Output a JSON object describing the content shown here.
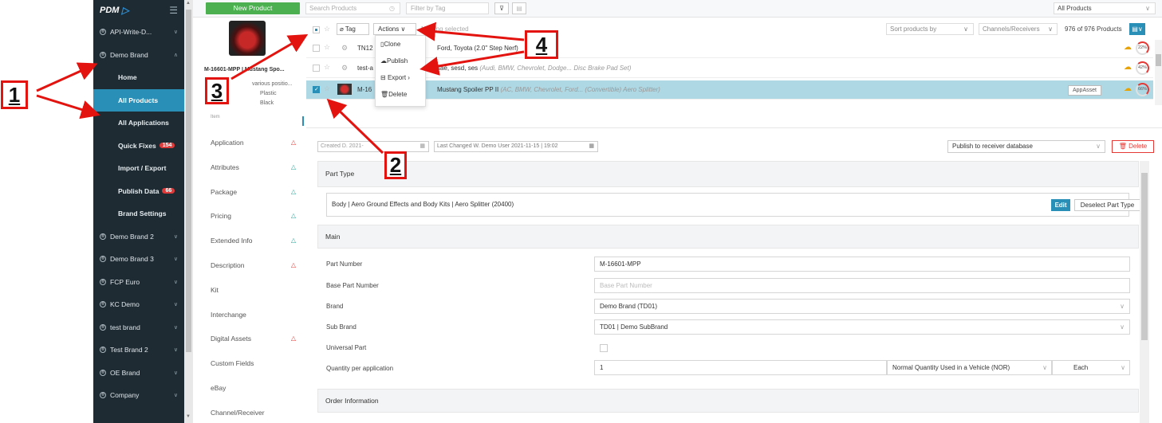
{
  "sidebar": {
    "logo": "PDM",
    "items": [
      {
        "label": "API-Write-D...",
        "type": "brand"
      },
      {
        "label": "Demo Brand",
        "type": "brand-open"
      },
      {
        "label": "Home",
        "type": "sub"
      },
      {
        "label": "All Products",
        "type": "sub-active"
      },
      {
        "label": "All Applications",
        "type": "sub"
      },
      {
        "label": "Quick Fixes",
        "type": "sub",
        "badge": "154"
      },
      {
        "label": "Import / Export",
        "type": "sub"
      },
      {
        "label": "Publish Data",
        "type": "sub",
        "badge": "66"
      },
      {
        "label": "Brand Settings",
        "type": "sub"
      },
      {
        "label": "Demo Brand 2",
        "type": "brand"
      },
      {
        "label": "Demo Brand 3",
        "type": "brand"
      },
      {
        "label": "FCP Euro",
        "type": "brand"
      },
      {
        "label": "KC Demo",
        "type": "brand"
      },
      {
        "label": "test brand",
        "type": "brand"
      },
      {
        "label": "Test Brand 2",
        "type": "brand"
      },
      {
        "label": "OE Brand",
        "type": "brand"
      },
      {
        "label": "Company",
        "type": "brand"
      }
    ]
  },
  "topbar": {
    "new_product": "New Product",
    "search_placeholder": "Search Products",
    "filter_placeholder": "Filter by Tag",
    "all_products": "All Products"
  },
  "preview": {
    "title": "M-16601-MPP | Mustang Spo...",
    "line1": "various positio...",
    "line2": "Plastic",
    "line3": "Black"
  },
  "list": {
    "tag_label": "Tag",
    "actions_label": "Actions",
    "no_selection": "Nothing selected",
    "sort_placeholder": "Sort products by",
    "channels_placeholder": "Channels/Receivers",
    "count": "976 of 976 Products",
    "rows": [
      {
        "sku": "TN12",
        "desc": "Ford, Toyota (2.0\" Step Nerf)",
        "extra": "",
        "pct": "22%",
        "selected": false
      },
      {
        "sku": "test-a",
        "desc": "sae, sesd, ses",
        "extra": "(Audi, BMW, Chevrolet, Dodge... Disc Brake Pad Set)",
        "pct": "42%",
        "selected": false
      },
      {
        "sku": "M-16",
        "desc": "Mustang Spoiler PP II",
        "extra": "(AC, BMW, Chevrolet, Ford... (Convertible) Aero Splitter)",
        "pct": "66%",
        "selected": true,
        "badge": "AppAsset"
      }
    ]
  },
  "dropdown": {
    "items": [
      "Clone",
      "Publish",
      "Export",
      "Delete"
    ]
  },
  "tabs": {
    "header": "Item",
    "items": [
      {
        "label": "Application",
        "warn": "red"
      },
      {
        "label": "Attributes",
        "warn": "teal"
      },
      {
        "label": "Package",
        "warn": "teal"
      },
      {
        "label": "Pricing",
        "warn": "teal"
      },
      {
        "label": "Extended Info",
        "warn": "teal"
      },
      {
        "label": "Description",
        "warn": "red"
      },
      {
        "label": "Kit",
        "warn": ""
      },
      {
        "label": "Interchange",
        "warn": ""
      },
      {
        "label": "Digital Assets",
        "warn": "red"
      },
      {
        "label": "Custom Fields",
        "warn": ""
      },
      {
        "label": "eBay",
        "warn": ""
      },
      {
        "label": "Channel/Receiver",
        "warn": ""
      }
    ]
  },
  "detail": {
    "created": "Created  D. 2021-",
    "last_changed": "Last Changed  W. Demo User 2021-11-15 | 19:02",
    "publish_select": "Publish to receiver database",
    "delete_label": "Delete",
    "part_type_header": "Part Type",
    "part_type_value": "Body | Aero Ground Effects and Body Kits | Aero Splitter (20400)",
    "edit_label": "Edit",
    "deselect_label": "Deselect Part Type",
    "main_header": "Main",
    "fields": {
      "part_number_label": "Part Number",
      "part_number_value": "M-16601-MPP",
      "base_part_label": "Base Part Number",
      "base_part_placeholder": "Base Part Number",
      "brand_label": "Brand",
      "brand_value": "Demo Brand (TD01)",
      "sub_brand_label": "Sub Brand",
      "sub_brand_value": "TD01 | Demo SubBrand",
      "universal_label": "Universal Part",
      "qty_label": "Quantity per application",
      "qty_value": "1",
      "qty_type": "Normal Quantity Used in a Vehicle (NOR)",
      "qty_unit": "Each"
    },
    "order_header": "Order Information"
  },
  "annotations": [
    "1",
    "2",
    "3",
    "4"
  ],
  "colors": {
    "accent": "#2a8fb7",
    "annotation": "#e3130f",
    "sidebar": "#1e2b33",
    "new_button": "#4caf50"
  }
}
